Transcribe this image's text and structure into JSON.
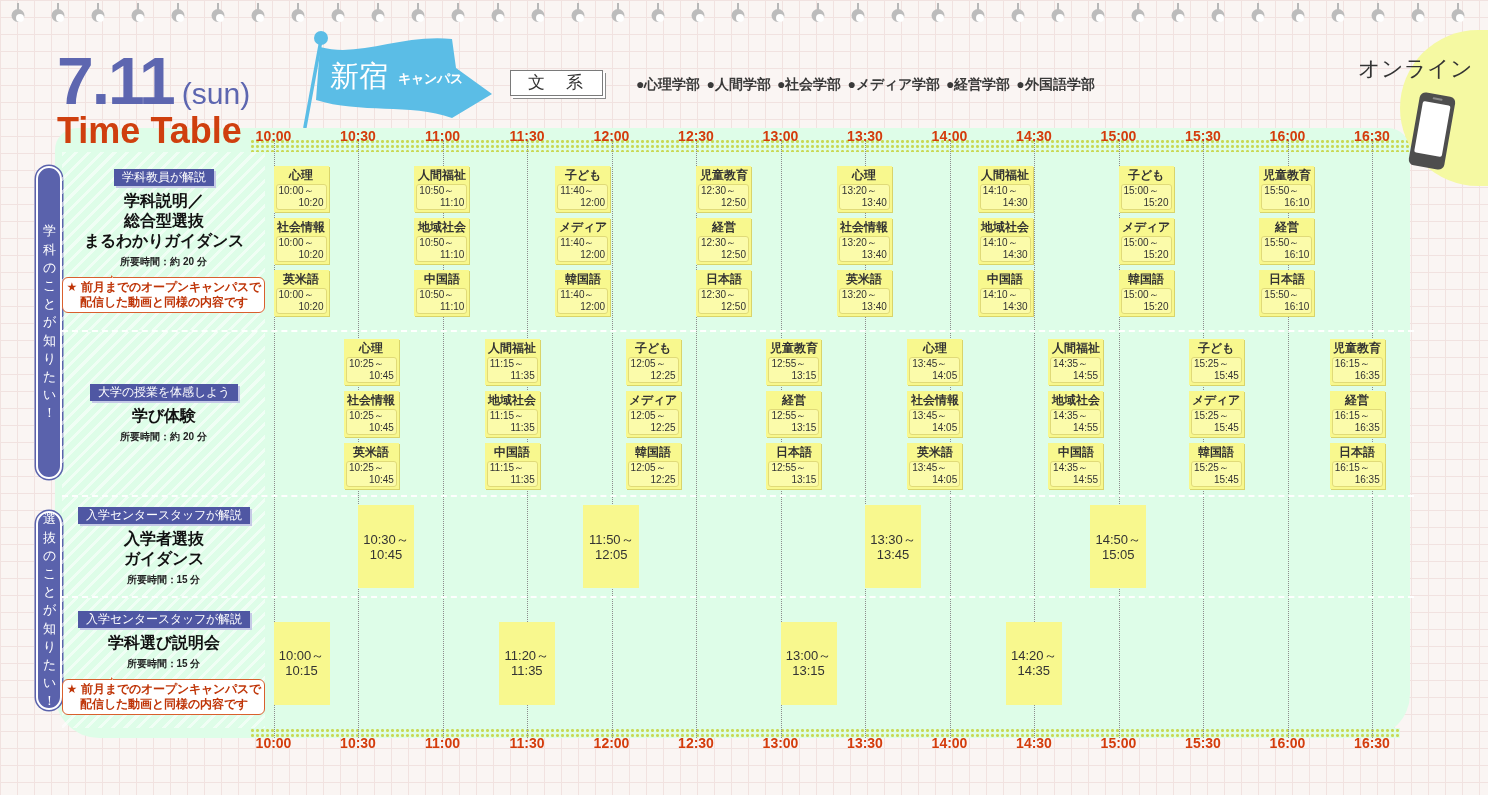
{
  "header": {
    "date": "7.11",
    "weekday": "(sun)",
    "title": "Time Table"
  },
  "campus": {
    "name": "新宿",
    "suffix": "キャンパス"
  },
  "category": {
    "label": "文　系",
    "faculties": [
      "●心理学部",
      "●人間学部",
      "●社会学部",
      "●メディア学部",
      "●経営学部",
      "●外国語学部"
    ]
  },
  "online": {
    "label": "オンライン"
  },
  "timetable": {
    "axis_top": [
      "10:00",
      "10:30",
      "11:00",
      "11:30",
      "12:00",
      "12:30",
      "13:00",
      "13:30",
      "14:00",
      "14:30",
      "15:00",
      "15:30",
      "16:00",
      "16:30"
    ],
    "sections": [
      {
        "label": "学科のことが知りたい！",
        "rows": [
          {
            "kind": "notes",
            "badge": "学科教員が解説",
            "title": [
              "学科説明／",
              "総合型選抜",
              "まるわかりガイダンス"
            ],
            "duration": "所要時間：約 20 分",
            "note": [
              "★ 前月までのオープンキャンパスで",
              "配信した動画と同様の内容です"
            ],
            "slots": [
              {
                "notes": [
                  {
                    "subject": "心理",
                    "start": "10:00～",
                    "end": "10:20"
                  },
                  {
                    "subject": "社会情報",
                    "start": "10:00～",
                    "end": "10:20"
                  },
                  {
                    "subject": "英米語",
                    "start": "10:00～",
                    "end": "10:20"
                  }
                ]
              },
              {
                "notes": [
                  {
                    "subject": "人間福祉",
                    "start": "10:50～",
                    "end": "11:10"
                  },
                  {
                    "subject": "地域社会",
                    "start": "10:50～",
                    "end": "11:10"
                  },
                  {
                    "subject": "中国語",
                    "start": "10:50～",
                    "end": "11:10"
                  }
                ]
              },
              {
                "notes": [
                  {
                    "subject": "子ども",
                    "start": "11:40～",
                    "end": "12:00"
                  },
                  {
                    "subject": "メディア",
                    "start": "11:40～",
                    "end": "12:00"
                  },
                  {
                    "subject": "韓国語",
                    "start": "11:40～",
                    "end": "12:00"
                  }
                ]
              },
              {
                "notes": [
                  {
                    "subject": "児童教育",
                    "start": "12:30～",
                    "end": "12:50"
                  },
                  {
                    "subject": "経営",
                    "start": "12:30～",
                    "end": "12:50"
                  },
                  {
                    "subject": "日本語",
                    "start": "12:30～",
                    "end": "12:50"
                  }
                ]
              },
              {
                "notes": [
                  {
                    "subject": "心理",
                    "start": "13:20～",
                    "end": "13:40"
                  },
                  {
                    "subject": "社会情報",
                    "start": "13:20～",
                    "end": "13:40"
                  },
                  {
                    "subject": "英米語",
                    "start": "13:20～",
                    "end": "13:40"
                  }
                ]
              },
              {
                "notes": [
                  {
                    "subject": "人間福祉",
                    "start": "14:10～",
                    "end": "14:30"
                  },
                  {
                    "subject": "地域社会",
                    "start": "14:10～",
                    "end": "14:30"
                  },
                  {
                    "subject": "中国語",
                    "start": "14:10～",
                    "end": "14:30"
                  }
                ]
              },
              {
                "notes": [
                  {
                    "subject": "子ども",
                    "start": "15:00～",
                    "end": "15:20"
                  },
                  {
                    "subject": "メディア",
                    "start": "15:00～",
                    "end": "15:20"
                  },
                  {
                    "subject": "韓国語",
                    "start": "15:00～",
                    "end": "15:20"
                  }
                ]
              },
              {
                "notes": [
                  {
                    "subject": "児童教育",
                    "start": "15:50～",
                    "end": "16:10"
                  },
                  {
                    "subject": "経営",
                    "start": "15:50～",
                    "end": "16:10"
                  },
                  {
                    "subject": "日本語",
                    "start": "15:50～",
                    "end": "16:10"
                  }
                ]
              }
            ]
          },
          {
            "kind": "notes",
            "badge": "大学の授業を体感しよう",
            "title": [
              "学び体験"
            ],
            "duration": "所要時間：約 20 分",
            "slots": [
              {
                "notes": [
                  {
                    "subject": "心理",
                    "start": "10:25～",
                    "end": "10:45"
                  },
                  {
                    "subject": "社会情報",
                    "start": "10:25～",
                    "end": "10:45"
                  },
                  {
                    "subject": "英米語",
                    "start": "10:25～",
                    "end": "10:45"
                  }
                ]
              },
              {
                "notes": [
                  {
                    "subject": "人間福祉",
                    "start": "11:15～",
                    "end": "11:35"
                  },
                  {
                    "subject": "地域社会",
                    "start": "11:15～",
                    "end": "11:35"
                  },
                  {
                    "subject": "中国語",
                    "start": "11:15～",
                    "end": "11:35"
                  }
                ]
              },
              {
                "notes": [
                  {
                    "subject": "子ども",
                    "start": "12:05～",
                    "end": "12:25"
                  },
                  {
                    "subject": "メディア",
                    "start": "12:05～",
                    "end": "12:25"
                  },
                  {
                    "subject": "韓国語",
                    "start": "12:05～",
                    "end": "12:25"
                  }
                ]
              },
              {
                "notes": [
                  {
                    "subject": "児童教育",
                    "start": "12:55～",
                    "end": "13:15"
                  },
                  {
                    "subject": "経営",
                    "start": "12:55～",
                    "end": "13:15"
                  },
                  {
                    "subject": "日本語",
                    "start": "12:55～",
                    "end": "13:15"
                  }
                ]
              },
              {
                "notes": [
                  {
                    "subject": "心理",
                    "start": "13:45～",
                    "end": "14:05"
                  },
                  {
                    "subject": "社会情報",
                    "start": "13:45～",
                    "end": "14:05"
                  },
                  {
                    "subject": "英米語",
                    "start": "13:45～",
                    "end": "14:05"
                  }
                ]
              },
              {
                "notes": [
                  {
                    "subject": "人間福祉",
                    "start": "14:35～",
                    "end": "14:55"
                  },
                  {
                    "subject": "地域社会",
                    "start": "14:35～",
                    "end": "14:55"
                  },
                  {
                    "subject": "中国語",
                    "start": "14:35～",
                    "end": "14:55"
                  }
                ]
              },
              {
                "notes": [
                  {
                    "subject": "子ども",
                    "start": "15:25～",
                    "end": "15:45"
                  },
                  {
                    "subject": "メディア",
                    "start": "15:25～",
                    "end": "15:45"
                  },
                  {
                    "subject": "韓国語",
                    "start": "15:25～",
                    "end": "15:45"
                  }
                ]
              },
              {
                "notes": [
                  {
                    "subject": "児童教育",
                    "start": "16:15～",
                    "end": "16:35"
                  },
                  {
                    "subject": "経営",
                    "start": "16:15～",
                    "end": "16:35"
                  },
                  {
                    "subject": "日本語",
                    "start": "16:15～",
                    "end": "16:35"
                  }
                ]
              }
            ]
          }
        ]
      },
      {
        "label": "選抜のことが知りたい！",
        "rows": [
          {
            "kind": "blocks",
            "badge": "入学センタースタッフが解説",
            "title": [
              "入学者選抜",
              "ガイダンス"
            ],
            "duration": "所要時間：15 分",
            "slots": [
              {
                "start": "10:30～",
                "end": "10:45"
              },
              {
                "start": "11:50～",
                "end": "12:05"
              },
              {
                "start": "13:30～",
                "end": "13:45"
              },
              {
                "start": "14:50～",
                "end": "15:05"
              }
            ]
          },
          {
            "kind": "blocks",
            "badge": "入学センタースタッフが解説",
            "title": [
              "学科選び説明会"
            ],
            "duration": "所要時間：15 分",
            "note": [
              "★ 前月までのオープンキャンパスで",
              "配信した動画と同様の内容です"
            ],
            "slots": [
              {
                "start": "10:00～",
                "end": "10:15"
              },
              {
                "start": "11:20～",
                "end": "11:35"
              },
              {
                "start": "13:00～",
                "end": "13:15"
              },
              {
                "start": "14:20～",
                "end": "14:35"
              }
            ]
          }
        ]
      }
    ],
    "axis_bottom": [
      "10:00",
      "10:30",
      "11:00",
      "11:30",
      "12:00",
      "12:30",
      "13:00",
      "13:30",
      "14:00",
      "14:30",
      "15:00",
      "15:30",
      "16:00",
      "16:30"
    ]
  }
}
